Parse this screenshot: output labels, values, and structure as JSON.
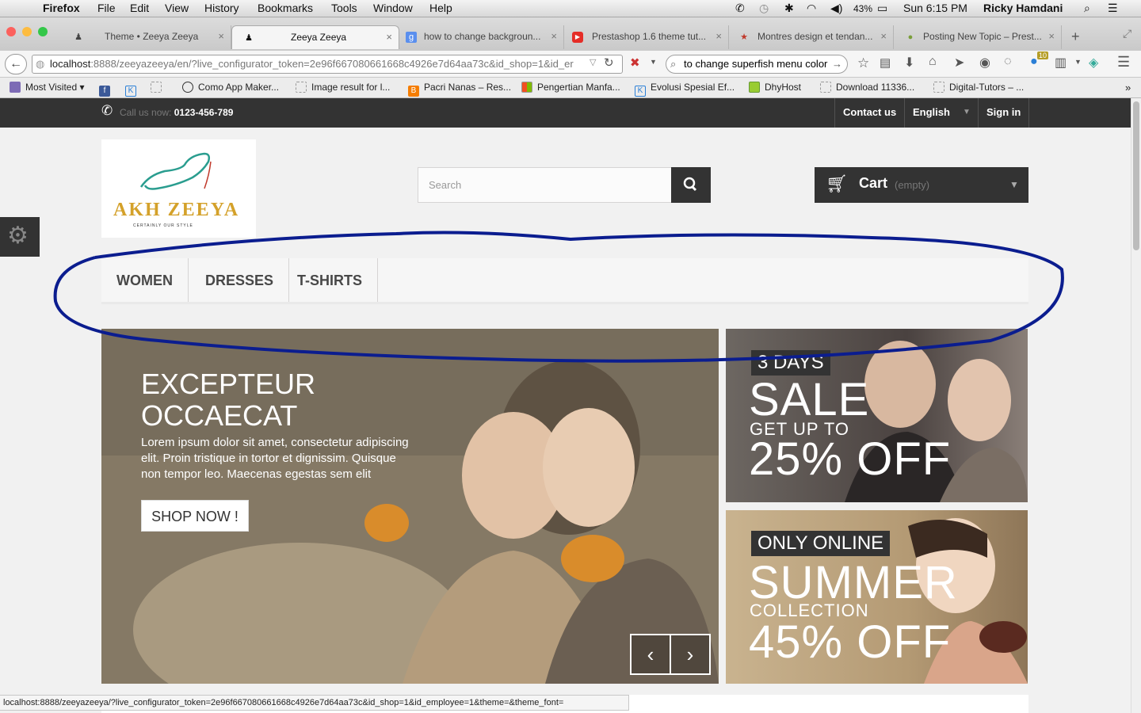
{
  "menubar": {
    "app": "Firefox",
    "items": [
      "File",
      "Edit",
      "View",
      "History",
      "Bookmarks",
      "Tools",
      "Window",
      "Help"
    ],
    "battery": "43%",
    "clock": "Sun 6:15 PM",
    "user": "Ricky Hamdani"
  },
  "tabs": [
    {
      "label": "Theme • Zeeya Zeeya"
    },
    {
      "label": "Zeeya Zeeya"
    },
    {
      "label": "how to change backgroun..."
    },
    {
      "label": "Prestashop 1.6 theme tut..."
    },
    {
      "label": "Montres design et tendan..."
    },
    {
      "label": "Posting New Topic – Prest..."
    }
  ],
  "urlbar": {
    "host": "localhost",
    "rest": ":8888/zeeyazeeya/en/?live_configurator_token=2e96f667080661668c4926e7d64aa73c&id_shop=1&id_er"
  },
  "search_bar": {
    "value": "to change superfish menu color"
  },
  "badge_count": "10",
  "bookmarks": [
    {
      "label": "Most Visited"
    },
    {
      "label": "Como App Maker..."
    },
    {
      "label": "Image result for l..."
    },
    {
      "label": "Pacri Nanas – Res..."
    },
    {
      "label": "Pengertian Manfa..."
    },
    {
      "label": "Evolusi Spesial Ef..."
    },
    {
      "label": "DhyHost"
    },
    {
      "label": "Download 11336..."
    },
    {
      "label": "Digital-Tutors – ..."
    }
  ],
  "site": {
    "call_prefix": "Call us now:",
    "phone": "0123-456-789",
    "contact": "Contact us",
    "language": "English",
    "signin": "Sign in",
    "logo_text": "AKH ZEEYA",
    "logo_tagline": "CERTAINLY OUR STYLE",
    "search_placeholder": "Search",
    "cart_label": "Cart",
    "cart_status": "(empty)",
    "menu": [
      "WOMEN",
      "DRESSES",
      "T-SHIRTS"
    ],
    "hero": {
      "title1": "EXCEPTEUR",
      "title2": "OCCAECAT",
      "text": "Lorem ipsum dolor sit amet, consectetur adipiscing elit. Proin tristique in tortor et dignissim. Quisque non tempor leo. Maecenas egestas sem elit",
      "button": "SHOP NOW !"
    },
    "banner1": {
      "tag": "3 DAYS",
      "big": "SALE",
      "small": "GET UP TO",
      "offer": "25% OFF"
    },
    "banner2": {
      "tag": "ONLY ONLINE",
      "big": "SUMMER",
      "small": "COLLECTION",
      "offer": "45% OFF"
    }
  },
  "status_url": "localhost:8888/zeeyazeeya/?live_configurator_token=2e96f667080661668c4926e7d64aa73c&id_shop=1&id_employee=1&theme=&theme_font="
}
